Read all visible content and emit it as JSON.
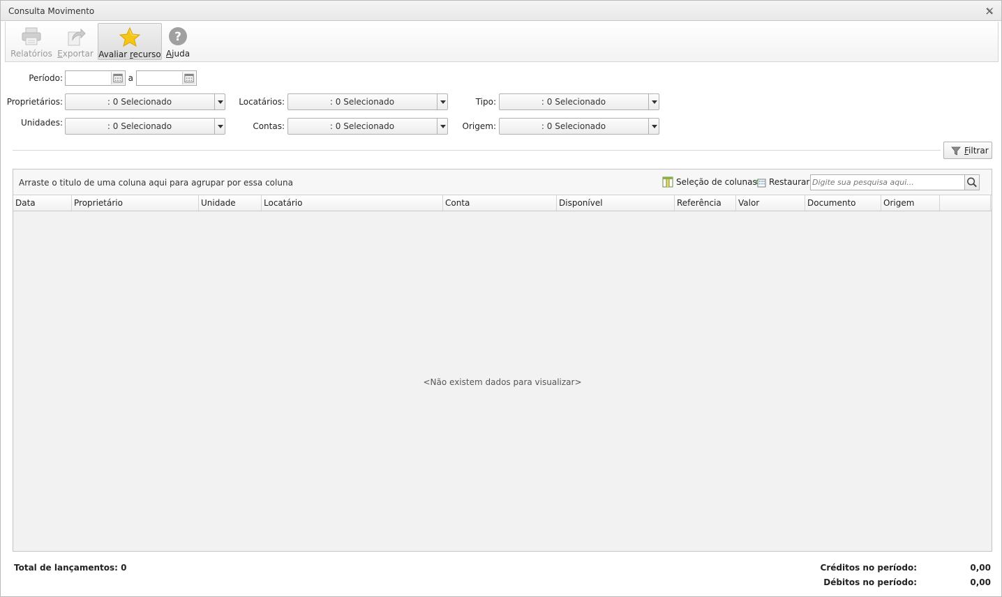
{
  "window": {
    "title": "Consulta Movimento"
  },
  "toolbar": {
    "reports_label": "Relatórios",
    "export_label": "Exportar",
    "rate_label_prefix": "Avaliar ",
    "rate_label_key": "r",
    "rate_label_suffix": "ecurso",
    "help_label_key": "A",
    "help_label_suffix": "juda",
    "export_label_key": "E",
    "export_label_suffix": "xportar"
  },
  "filters": {
    "period_label": "Período:",
    "period_start": "",
    "period_separator": "a",
    "period_end": "",
    "owners_label": "Proprietários:",
    "owners_value": ": 0 Selecionado",
    "tenants_label": "Locatários:",
    "tenants_value": ": 0 Selecionado",
    "type_label": "Tipo:",
    "type_value": ": 0 Selecionado",
    "units_label": "Unidades:",
    "units_value": ": 0 Selecionado",
    "accounts_label": "Contas:",
    "accounts_value": ": 0 Selecionado",
    "origin_label": "Origem:",
    "origin_value": ": 0 Selecionado",
    "filter_button_key": "F",
    "filter_button_suffix": "iltrar"
  },
  "grid": {
    "group_panel_text": "Arraste o titulo de uma coluna aqui para agrupar por essa coluna",
    "column_selection_label": "Seleção de colunas",
    "restore_label": "Restaurar",
    "search_placeholder": "Digite sua pesquisa aqui...",
    "columns": [
      "Data",
      "Proprietário",
      "Unidade",
      "Locatário",
      "Conta",
      "Disponível",
      "Referência",
      "Valor",
      "Documento",
      "Origem"
    ],
    "empty_message": "<Não existem dados para visualizar>"
  },
  "footer": {
    "total_label": "Total de lançamentos: 0",
    "credits_label": "Créditos no período:",
    "credits_value": "0,00",
    "debits_label": "Débitos no período:",
    "debits_value": "0,00"
  },
  "colors": {
    "accent_star": "#f5c518",
    "help_icon": "#9a9a9a"
  }
}
